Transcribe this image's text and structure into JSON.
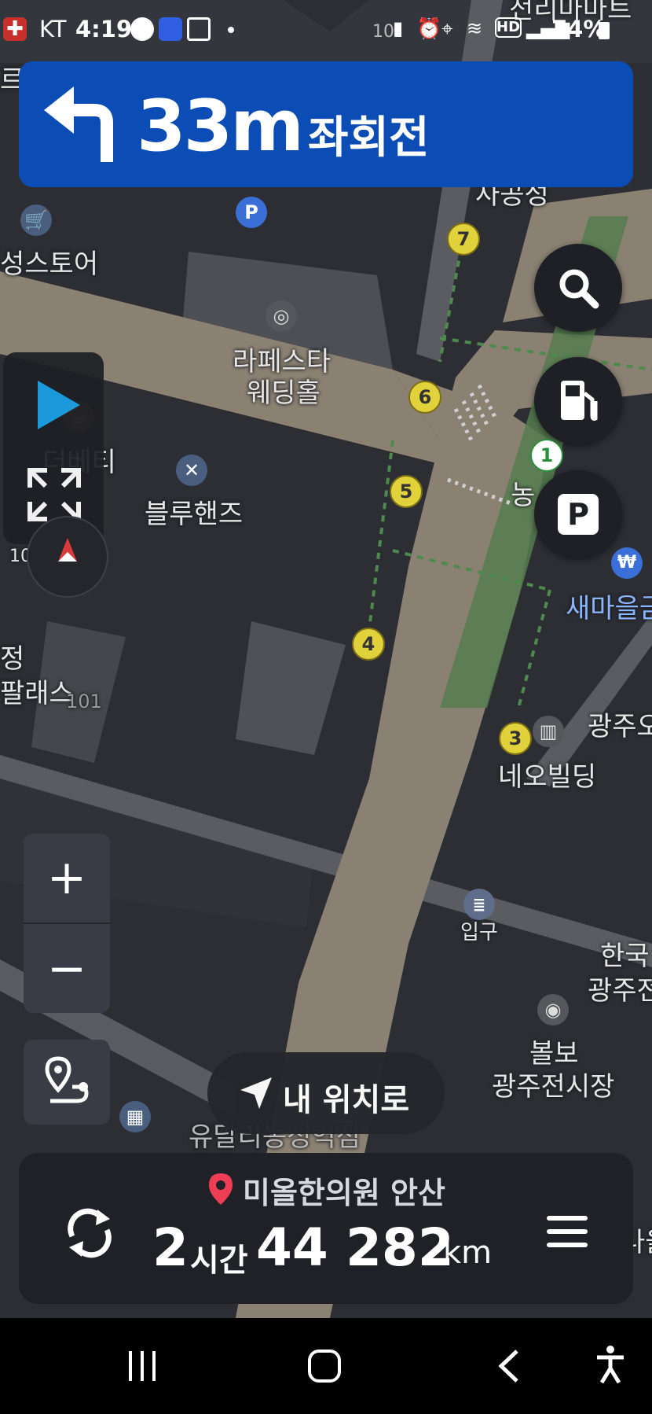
{
  "status_bar": {
    "carrier": "KT",
    "time": "4:19",
    "battery": "74%",
    "small_left": "10"
  },
  "banner": {
    "distance": "33m",
    "road": "좌회전",
    "turn_icon": "turn-left-arrow-icon",
    "color": "#0b4db5"
  },
  "map": {
    "labels": {
      "top_right": "전리마마트",
      "top_left": "르온",
      "right_top": "사공성",
      "store_left": "성스토어",
      "wedding_1": "라페스타",
      "wedding_2": "웨딩홀",
      "cafe": "더베티",
      "blue_hands": "블루핸즈",
      "left_10": "10",
      "left_jeong": "정",
      "left_palace": "팔래스",
      "building_101": "101",
      "nong": "농",
      "saemaeul": "새마을금",
      "gwangju_o": "광주오",
      "neo": "네오빌딩",
      "entrance": "입구",
      "korea_1": "한국",
      "korea_2": "광주전",
      "bolbo_1": "볼보",
      "bolbo_2": "광주전시장",
      "yudal": "유달리농성역점",
      "right_bottom": "나울"
    },
    "stops": [
      "7",
      "6",
      "5",
      "4",
      "3"
    ],
    "green_stop": "1"
  },
  "controls": {
    "search_icon": "search-icon",
    "fuel_icon": "fuel-station-icon",
    "parking_label": "P",
    "play_icon": "play-icon",
    "fullscreen_icon": "expand-icon",
    "compass_icon": "compass-icon",
    "zoom_in_label": "+",
    "zoom_out_label": "−",
    "route_icon": "route-options-icon",
    "my_location_label": "내 위치로"
  },
  "route_card": {
    "destination": "미올한의원 안산",
    "eta_hours": "2",
    "eta_hour_unit": "시간",
    "eta_minutes": "44",
    "distance_value": "282",
    "distance_unit": "km"
  },
  "navbar": {
    "recents_icon": "recents-icon",
    "home_icon": "home-icon",
    "back_icon": "back-icon",
    "accessibility_icon": "accessibility-icon"
  }
}
